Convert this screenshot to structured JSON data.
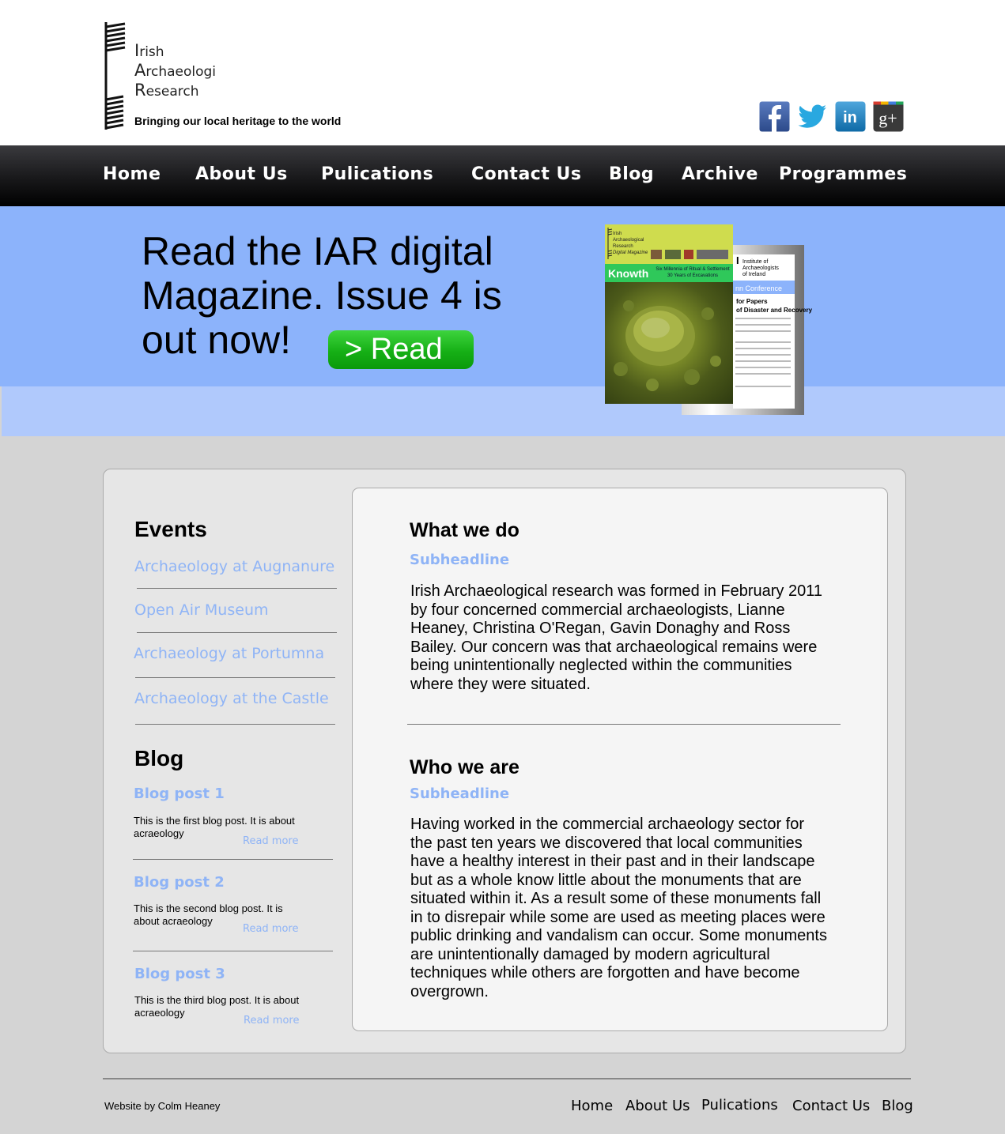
{
  "header": {
    "logo_words": [
      {
        "cap": "I",
        "rest": "rish"
      },
      {
        "cap": "A",
        "rest": "rchaeologi"
      },
      {
        "cap": "R",
        "rest": "esearch"
      }
    ],
    "tagline": "Bringing our local heritage to the world",
    "social": [
      {
        "name": "facebook",
        "glyph": "f",
        "color": "#3b5998"
      },
      {
        "name": "twitter",
        "color": "#29a8e0"
      },
      {
        "name": "linkedin",
        "glyph": "in",
        "color": "#1a7fbf"
      },
      {
        "name": "google-plus",
        "glyph": "g+",
        "color": "#4a4a4a"
      }
    ]
  },
  "nav": {
    "items": [
      "Home",
      "About Us",
      "Pulications",
      "Contact Us",
      "Blog",
      "Archive",
      "Programmes"
    ]
  },
  "hero": {
    "title": "Read the IAR digital Magazine. Issue 4 is out now!",
    "button": "> Read",
    "colors": {
      "top": "#8cb3fb",
      "bottom": "#b0c9fc",
      "button": "#16b016"
    }
  },
  "magazines": {
    "front": {
      "brand": [
        "Irish",
        "Archaeological",
        "Research",
        "Digital Magazine"
      ],
      "title": "Knowth",
      "subtitle": "Six Millennia of Ritual & Settlement 30 Years of Excavations"
    },
    "back": {
      "org": [
        "Institute of",
        "Archaeologists",
        "of Ireland"
      ],
      "band": "nn Conference",
      "cfp": [
        "for Papers",
        "of Disaster and Recovery"
      ]
    }
  },
  "events": {
    "heading": "Events",
    "items": [
      "Archaeology at Augnanure",
      "Open Air Museum",
      "Archaeology at Portumna",
      "Archaeology at the Castle"
    ]
  },
  "blog": {
    "heading": "Blog",
    "posts": [
      {
        "title": "Blog post 1",
        "text": "This is the first blog post. It is about acraeology",
        "more": "Read more"
      },
      {
        "title": "Blog post 2",
        "text": "This is the second blog post. It is about acraeology",
        "more": "Read more"
      },
      {
        "title": "Blog post 3",
        "text": "This is the third blog post. It is about acraeology",
        "more": "Read more"
      }
    ]
  },
  "main": {
    "sections": [
      {
        "heading": "What we do",
        "sub": "Subheadline",
        "body": "Irish Archaeological research was formed in February 2011 by four concerned commercial archaeologists, Lianne Heaney, Christina O'Regan, Gavin Donaghy and Ross Bailey. Our concern was that archaeological remains were being unintentionally neglected within the communities where they were situated."
      },
      {
        "heading": "Who we are",
        "sub": "Subheadline",
        "body": "Having worked in the commercial archaeology sector for the past ten years we discovered that local communities have a healthy interest in their past and in their landscape but as a whole know little about the monuments that are situated within it. As a result some of these monuments fall in to disrepair while some are used as meeting places were public drinking and vandalism can occur. Some monuments are unintentionally damaged by modern agricultural techniques while others are forgotten and have become overgrown."
      }
    ]
  },
  "footer": {
    "credit": "Website by Colm Heaney",
    "links": [
      "Home",
      "About Us",
      "Pulications",
      "Contact Us",
      "Blog"
    ]
  }
}
